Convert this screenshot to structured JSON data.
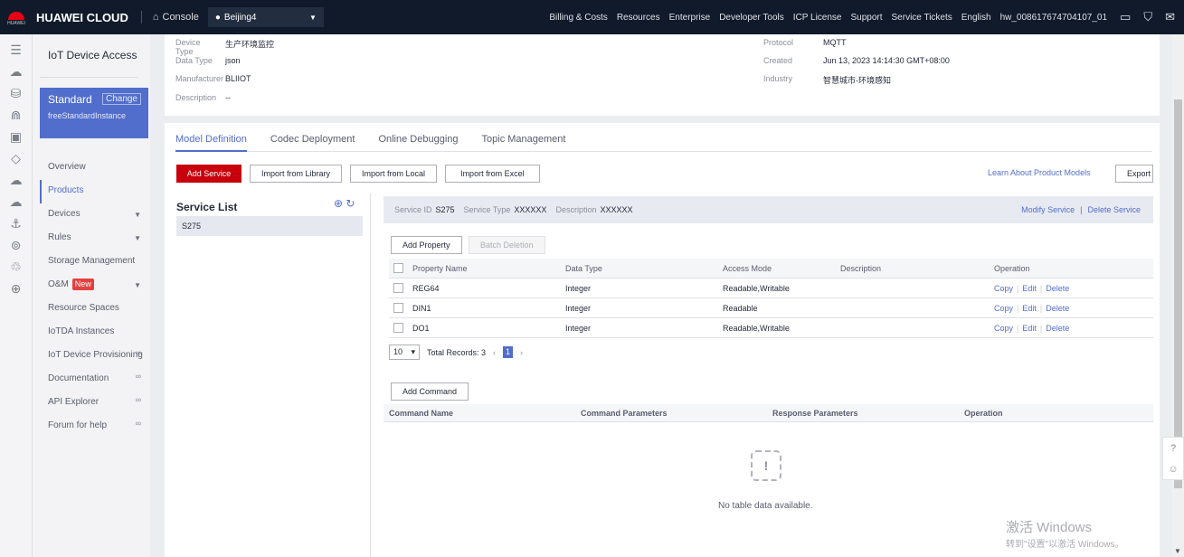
{
  "header": {
    "logo_text": "HUAWEI",
    "brand": "HUAWEI CLOUD",
    "console": "Console",
    "region": "Beijing4",
    "nav": [
      "Billing & Costs",
      "Resources",
      "Enterprise",
      "Developer Tools",
      "ICP License",
      "Support",
      "Service Tickets",
      "English",
      "hw_008617674704107_01"
    ]
  },
  "sidebar": {
    "title": "IoT Device Access",
    "instance": {
      "name": "Standard",
      "change": "Change",
      "id": "freeStandardInstance"
    },
    "items": [
      {
        "label": "Overview"
      },
      {
        "label": "Products"
      },
      {
        "label": "Devices"
      },
      {
        "label": "Rules"
      },
      {
        "label": "Storage Management"
      },
      {
        "label": "O&M",
        "badge": "New"
      },
      {
        "label": "Resource Spaces"
      },
      {
        "label": "IoTDA Instances"
      },
      {
        "label": "IoT Device Provisioning"
      },
      {
        "label": "Documentation"
      },
      {
        "label": "API Explorer"
      },
      {
        "label": "Forum for help"
      }
    ]
  },
  "info": {
    "device_type_k": "Device Type",
    "device_type_v": "生产环境监控",
    "data_type_k": "Data Type",
    "data_type_v": "json",
    "manufacturer_k": "Manufacturer",
    "manufacturer_v": "BLIIOT",
    "description_k": "Description",
    "description_v": "--",
    "protocol_k": "Protocol",
    "protocol_v": "MQTT",
    "created_k": "Created",
    "created_v": "Jun 13, 2023 14:14:30 GMT+08:00",
    "industry_k": "Industry",
    "industry_v": "智慧城市-环境感知"
  },
  "tabs": [
    "Model Definition",
    "Codec Deployment",
    "Online Debugging",
    "Topic Management"
  ],
  "toolbar": {
    "add_service": "Add Service",
    "import_library": "Import from Library",
    "import_local": "Import from Local",
    "import_excel": "Import from Excel",
    "learn": "Learn About Product Models",
    "export": "Export"
  },
  "service_list": {
    "title": "Service List",
    "items": [
      "S275"
    ]
  },
  "service_bar": {
    "id_k": "Service ID",
    "id_v": "S275",
    "type_k": "Service Type",
    "type_v": "XXXXXX",
    "desc_k": "Description",
    "desc_v": "XXXXXX",
    "modify": "Modify Service",
    "delete": "Delete Service"
  },
  "properties": {
    "add": "Add Property",
    "batch_delete": "Batch Deletion",
    "headers": [
      "Property Name",
      "Data Type",
      "Access Mode",
      "Description",
      "Operation"
    ],
    "rows": [
      {
        "name": "REG64",
        "type": "Integer",
        "access": "Readable,Writable",
        "desc": ""
      },
      {
        "name": "DIN1",
        "type": "Integer",
        "access": "Readable",
        "desc": ""
      },
      {
        "name": "DO1",
        "type": "Integer",
        "access": "Readable,Writable",
        "desc": ""
      }
    ],
    "ops": [
      "Copy",
      "Edit",
      "Delete"
    ]
  },
  "pager": {
    "size": "10",
    "total": "Total Records: 3",
    "page": "1"
  },
  "commands": {
    "add": "Add Command",
    "headers": [
      "Command Name",
      "Command Parameters",
      "Response Parameters",
      "Operation"
    ],
    "empty": "No table data available."
  },
  "watermark": {
    "line1": "激活 Windows",
    "line2": "转到\"设置\"以激活 Windows。"
  }
}
